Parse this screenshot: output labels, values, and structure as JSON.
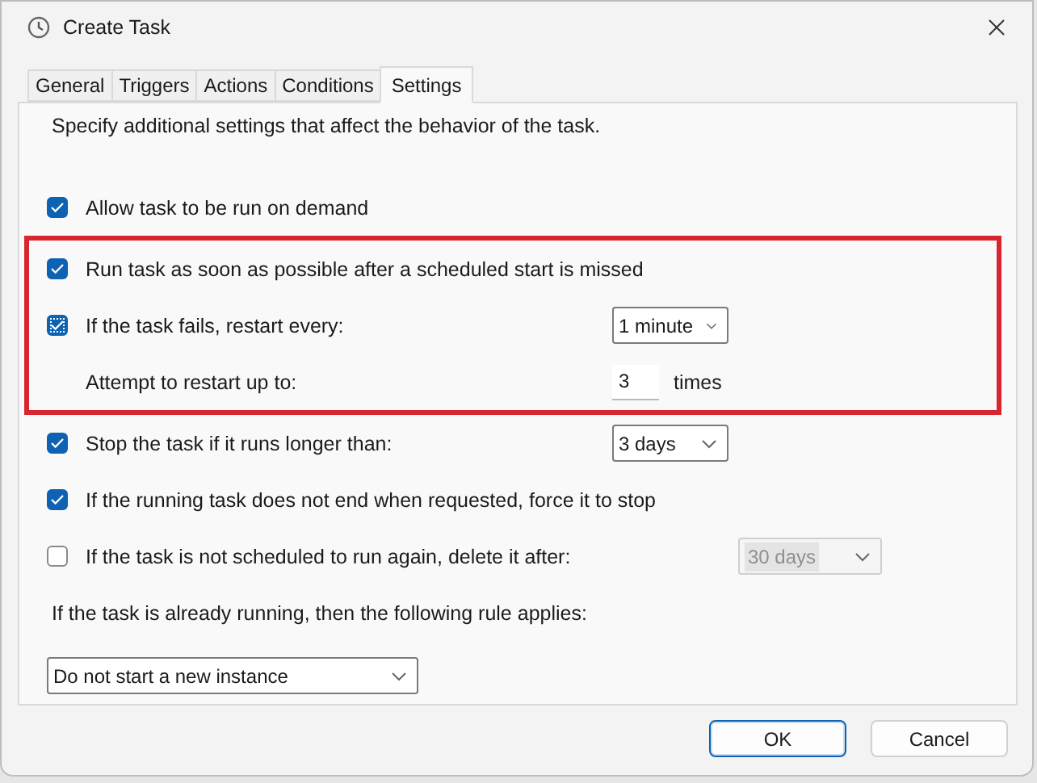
{
  "window": {
    "title": "Create Task"
  },
  "tabs": [
    {
      "label": "General",
      "selected": false
    },
    {
      "label": "Triggers",
      "selected": false
    },
    {
      "label": "Actions",
      "selected": false
    },
    {
      "label": "Conditions",
      "selected": false
    },
    {
      "label": "Settings",
      "selected": true
    }
  ],
  "description": "Specify additional settings that affect the behavior of the task.",
  "rows": [
    {
      "kind": "checkbox",
      "label": "Allow task to be run on demand",
      "checked": true,
      "focused": false,
      "highlighted": false
    },
    {
      "kind": "checkbox",
      "label": "Run task as soon as possible after a scheduled start is missed",
      "checked": true,
      "focused": false,
      "highlighted": true
    },
    {
      "kind": "checkbox",
      "label": "If the task fails, restart every:",
      "checked": true,
      "focused": true,
      "highlighted": true,
      "control": {
        "kind": "combo",
        "value": "1 minute",
        "disabled": false
      }
    },
    {
      "kind": "plain",
      "label": "Attempt to restart up to:",
      "highlighted": true,
      "control": {
        "kind": "number",
        "value": "3",
        "suffix": "times"
      }
    },
    {
      "kind": "checkbox",
      "label": "Stop the task if it runs longer than:",
      "checked": true,
      "focused": false,
      "highlighted": false,
      "control": {
        "kind": "combo",
        "value": "3 days",
        "disabled": false
      }
    },
    {
      "kind": "checkbox",
      "label": "If the running task does not end when requested, force it to stop",
      "checked": true,
      "focused": false,
      "highlighted": false
    },
    {
      "kind": "checkbox",
      "label": "If the task is not scheduled to run again, delete it after:",
      "checked": false,
      "focused": false,
      "highlighted": false,
      "control": {
        "kind": "combo",
        "value": "30 days",
        "disabled": true
      }
    }
  ],
  "rule": {
    "label": "If the task is already running, then the following rule applies:",
    "value": "Do not start a new instance"
  },
  "buttons": [
    {
      "label": "OK",
      "default": true
    },
    {
      "label": "Cancel",
      "default": false
    }
  ]
}
